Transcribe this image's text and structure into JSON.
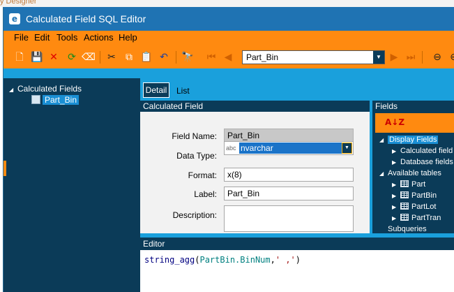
{
  "background_app": {
    "title_fragment": "y Designer"
  },
  "window": {
    "title": "Calculated Field SQL Editor",
    "icon": "epicor-e-icon"
  },
  "menu": [
    "File",
    "Edit",
    "Tools",
    "Actions",
    "Help"
  ],
  "toolbar": {
    "buttons": [
      "new-icon",
      "save-icon",
      "delete-icon",
      "refresh-icon",
      "clear-icon",
      "cut-icon",
      "copy-icon",
      "paste-icon",
      "undo-icon",
      "search-icon",
      "first-record-icon",
      "prev-record-icon",
      "next-record-icon",
      "last-record-icon",
      "back-icon"
    ],
    "record_value": "Part_Bin"
  },
  "tree": {
    "root": "Calculated Fields",
    "children": [
      "Part_Bin"
    ]
  },
  "tabs": [
    "Detail",
    "List"
  ],
  "calculated_field": {
    "header": "Calculated Field",
    "field_name_label": "Field Name:",
    "field_name": "Part_Bin",
    "data_type_label": "Data Type:",
    "data_type_tag": "abc",
    "data_type": "nvarchar",
    "format_label": "Format:",
    "format": "x(8)",
    "label_label": "Label:",
    "label": "Part_Bin",
    "description_label": "Description:",
    "description": ""
  },
  "fields": {
    "header": "Fields",
    "sort_icon_text": "A↓Z",
    "display_fields": "Display Fields",
    "calculated_fields": "Calculated field",
    "database_fields": "Database fields",
    "available_tables": "Available tables",
    "tables": [
      "Part",
      "PartBin",
      "PartLot",
      "PartTran"
    ],
    "subqueries": "Subqueries"
  },
  "editor": {
    "header": "Editor",
    "code_fn": "string_agg",
    "code_open": "(",
    "code_field": "PartBin.BinNum",
    "code_comma": ",",
    "code_str": "' ,'",
    "code_close": ")"
  },
  "colors": {
    "accent_orange": "#ff8a10",
    "dark_navy": "#0b3b58",
    "light_blue": "#1aa0dc",
    "title_blue": "#1f73b3",
    "selection_blue": "#1a8fd4"
  }
}
